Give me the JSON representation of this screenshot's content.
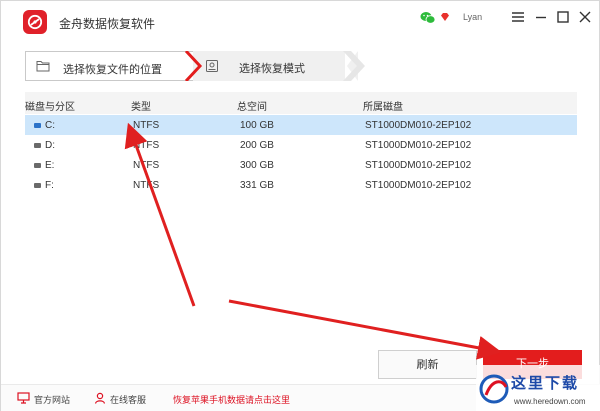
{
  "app": {
    "title": "金舟数据恢复软件",
    "user": "Lyan"
  },
  "steps": [
    {
      "label": "选择恢复文件的位置"
    },
    {
      "label": "选择恢复模式"
    }
  ],
  "table": {
    "columns": [
      "磁盘与分区",
      "类型",
      "总空间",
      "所属磁盘"
    ],
    "rows": [
      {
        "name": "C:",
        "type": "NTFS",
        "size": "100 GB",
        "disk": "ST1000DM010-2EP102",
        "selected": true
      },
      {
        "name": "D:",
        "type": "NTFS",
        "size": "200 GB",
        "disk": "ST1000DM010-2EP102",
        "selected": false
      },
      {
        "name": "E:",
        "type": "NTFS",
        "size": "300 GB",
        "disk": "ST1000DM010-2EP102",
        "selected": false
      },
      {
        "name": "F:",
        "type": "NTFS",
        "size": "331 GB",
        "disk": "ST1000DM010-2EP102",
        "selected": false
      }
    ]
  },
  "buttons": {
    "refresh": "刷新",
    "next": "下一步"
  },
  "footer": {
    "website": "官方网站",
    "support": "在线客服",
    "promo": "恢复苹果手机数据请点击这里"
  },
  "watermark": {
    "text": "这里下载",
    "url": "www.heredown.com"
  },
  "colors": {
    "accent": "#e31d1d",
    "selected_row": "#cde6fb",
    "annotation": "#e02020"
  }
}
